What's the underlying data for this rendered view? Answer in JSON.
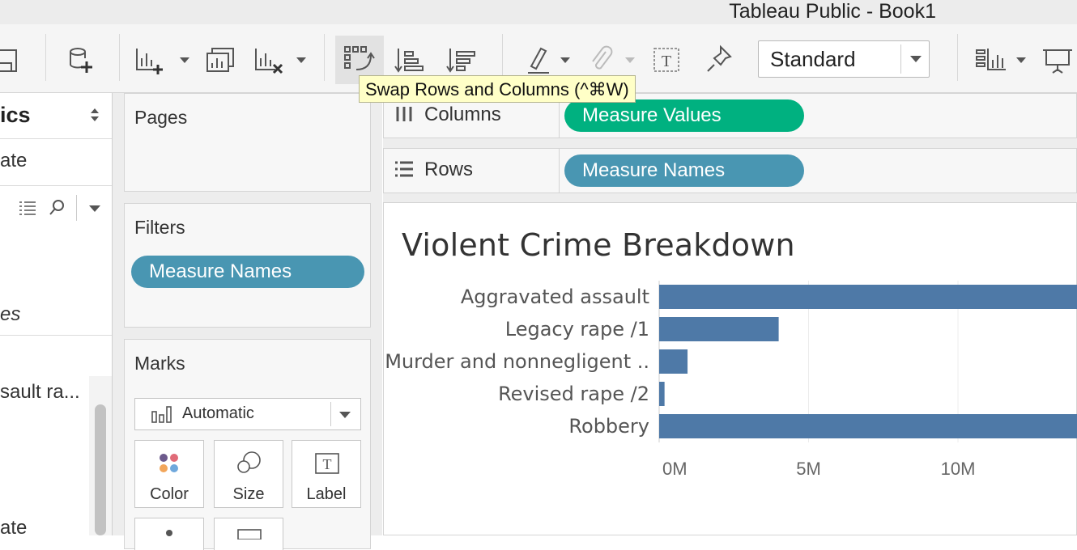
{
  "window": {
    "title": "Tableau Public - Book1"
  },
  "toolbar": {
    "swap_tooltip": "Swap Rows and Columns (^⌘W)",
    "fit_select": "Standard"
  },
  "data_pane": {
    "header": "ics",
    "row1": "ate",
    "row2": "es",
    "row3": "sault ra...",
    "row4": "ate"
  },
  "pages": {
    "title": "Pages"
  },
  "filters": {
    "title": "Filters",
    "pills": [
      "Measure Names"
    ]
  },
  "marks": {
    "title": "Marks",
    "type": "Automatic",
    "buttons": [
      "Color",
      "Size",
      "Label"
    ]
  },
  "shelves": {
    "columns_label": "Columns",
    "columns_pill": "Measure Values",
    "rows_label": "Rows",
    "rows_pill": "Measure Names"
  },
  "colors": {
    "bar": "#4e79a7",
    "pill_blue": "#4996b2",
    "pill_green": "#00b180"
  },
  "chart_data": {
    "type": "bar",
    "orientation": "horizontal",
    "title": "Violent Crime Breakdown",
    "categories": [
      "Aggravated assault",
      "Legacy rape /1",
      "Murder and nonnegligent ..",
      "Revised rape /2",
      "Robbery"
    ],
    "values": [
      14200000,
      4000000,
      950000,
      180000,
      14200000
    ],
    "x_ticks": [
      "0M",
      "5M",
      "10M"
    ],
    "x_tick_values": [
      0,
      5000000,
      10000000
    ],
    "xlim": [
      0,
      14000000
    ],
    "grid": true
  }
}
